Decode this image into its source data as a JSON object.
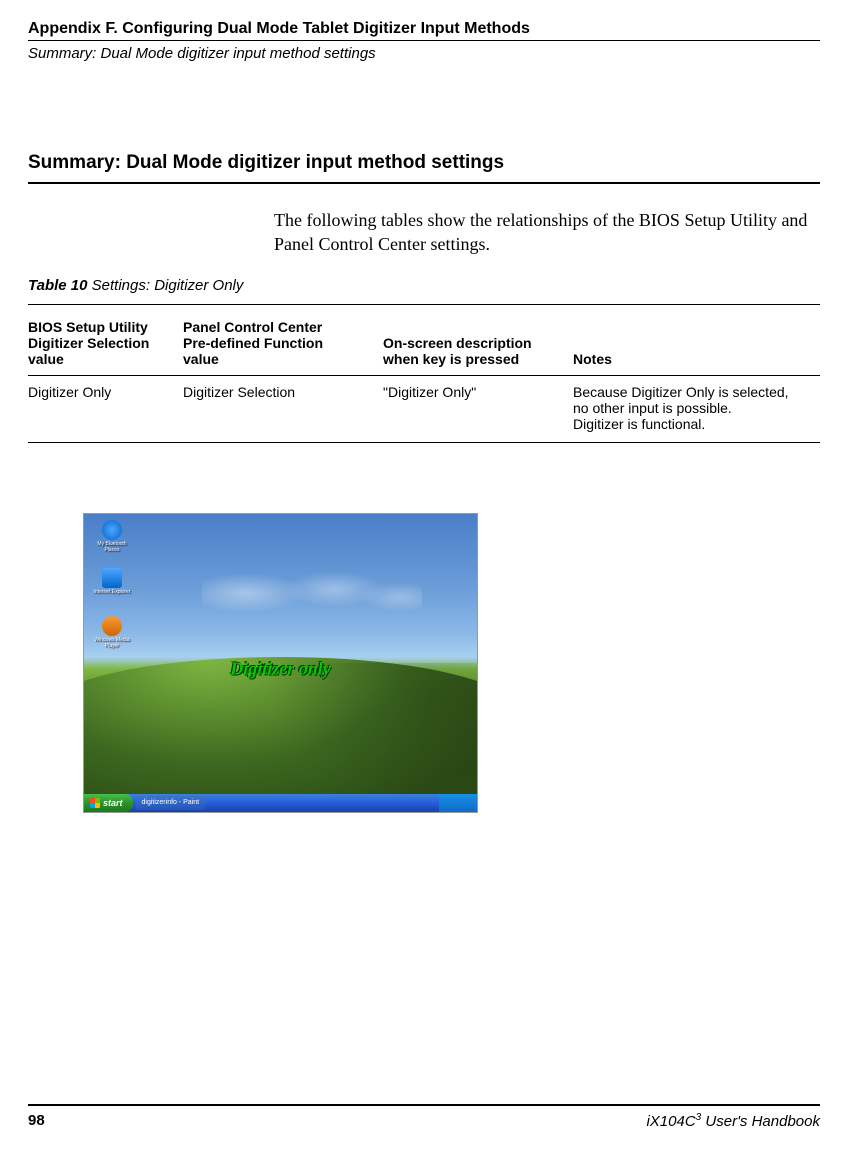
{
  "header": {
    "appendix_title": "Appendix F. Configuring Dual Mode Tablet Digitizer Input Methods",
    "subtitle": "Summary: Dual Mode digitizer input method settings"
  },
  "section_heading": "Summary: Dual Mode digitizer input method settings",
  "intro_text": "The following tables show the relationships of the BIOS Setup Utility and Panel Control Center settings.",
  "table_caption": {
    "label": "Table 10",
    "title": "Settings: Digitizer Only"
  },
  "table": {
    "headers": {
      "col1a": "BIOS Setup Utility",
      "col1b": "Digitizer Selection",
      "col1c": "value",
      "col2a": "Panel Control Center",
      "col2b": "Pre-defined Function",
      "col2c": "value",
      "col3a": "On-screen description",
      "col3b": "when key is pressed",
      "col4": "Notes"
    },
    "rows": [
      {
        "bios": "Digitizer Only",
        "panel": "Digitizer Selection",
        "onscreen": "\"Digitizer Only\"",
        "notes_line1": "Because Digitizer Only is selected,",
        "notes_line2": "no other input is possible.",
        "notes_line3": "Digitizer is functional."
      }
    ]
  },
  "screenshot": {
    "icons": [
      {
        "name": "bluetooth-icon",
        "label": "My Bluetooth Places"
      },
      {
        "name": "internet-explorer-icon",
        "label": "Internet Explorer"
      },
      {
        "name": "windows-media-player-icon",
        "label": "Windows Media Player"
      }
    ],
    "overlay": "Digitizer only",
    "start_label": "start",
    "task_item": "digitizerinfo - Paint"
  },
  "footer": {
    "page": "98",
    "handbook_prefix": "iX104C",
    "handbook_sup": "3",
    "handbook_suffix": " User's Handbook"
  }
}
